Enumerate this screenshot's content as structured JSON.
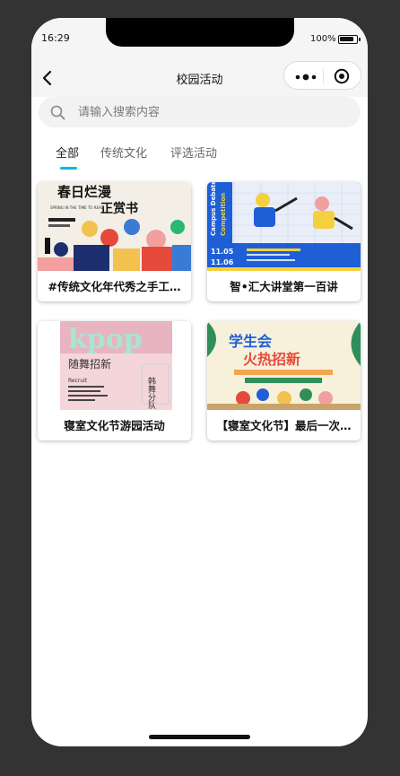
{
  "status": {
    "time": "16:29",
    "battery": "100%"
  },
  "nav": {
    "title": "校园活动"
  },
  "search": {
    "placeholder": "请输入搜索内容"
  },
  "tabs": [
    {
      "label": "全部",
      "active": true
    },
    {
      "label": "传统文化",
      "active": false
    },
    {
      "label": "评选活动",
      "active": false
    }
  ],
  "accent_color": "#00bcd4",
  "cards": [
    {
      "title": "#传统文化年代秀之手工…",
      "image": {
        "headline": "春日烂漫",
        "subheadline": "正赏书",
        "small_text": "SPRING IN THE TIME TO READ"
      }
    },
    {
      "title": "智•汇大讲堂第一百讲",
      "image": {
        "headline": "Campus Debate",
        "subheadline": "Competition",
        "date_1": "11.05",
        "date_2": "11.06"
      }
    },
    {
      "title": "寝室文化节游园活动",
      "image": {
        "headline": "kpop",
        "subheadline": "随舞招新",
        "side_text": "韩舞分队",
        "small_text": "Recruit"
      }
    },
    {
      "title": "【寝室文化节】最后一次…",
      "image": {
        "headline": "学生会",
        "subheadline": "火热招新"
      }
    }
  ]
}
